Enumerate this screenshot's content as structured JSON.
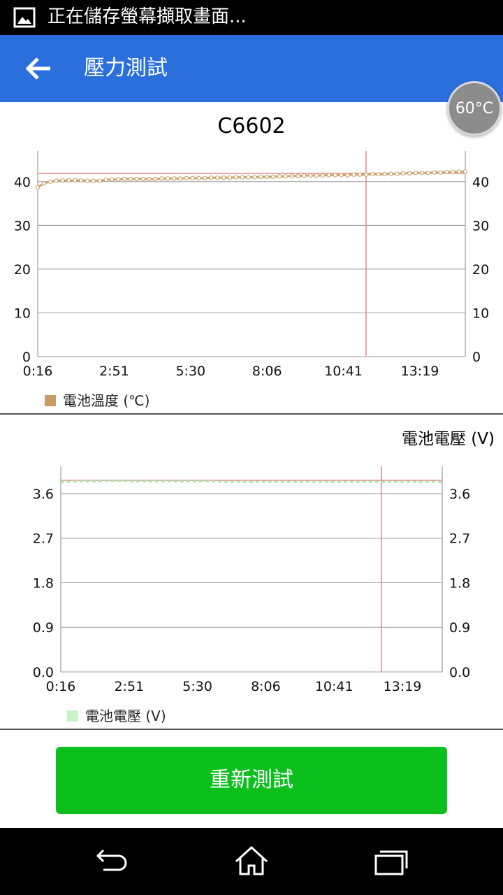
{
  "status_bar": {
    "notification_text": "正在儲存螢幕擷取畫面...",
    "icon": "image-icon"
  },
  "app_bar": {
    "title": "壓力測試",
    "back_icon": "arrow-left-icon",
    "color": "#2a6fdc"
  },
  "temperature_bubble": {
    "text": "60°C"
  },
  "device_name": "C6602",
  "temp_chart": {
    "legend": "電池溫度 (℃)",
    "color": "#d1a46e"
  },
  "voltage_chart": {
    "title": "電池電壓 (V)",
    "legend": "電池電壓 (V)",
    "color": "#c8f5c8"
  },
  "retest_button": {
    "label": "重新測試",
    "color": "#0bbf1d"
  },
  "nav_bar": {
    "icons": [
      "back-nav-icon",
      "home-icon",
      "recent-apps-icon"
    ]
  },
  "chart_data": [
    {
      "type": "line",
      "x_ticks": [
        "0:16",
        "2:51",
        "5:30",
        "8:06",
        "10:41",
        "13:19"
      ],
      "y_ticks": [
        "0",
        "10",
        "20",
        "30",
        "40"
      ],
      "ylim": [
        0,
        47
      ],
      "grid": true,
      "legend_position": "bottom-left",
      "reference_line_y": 41.9,
      "marker_x_label": "10:41",
      "series": [
        {
          "name": "電池溫度 (℃)",
          "values": [
            38.7,
            39.6,
            40.0,
            40.2,
            40.3,
            40.3,
            40.3,
            40.3,
            40.2,
            40.2,
            40.2,
            40.4,
            40.5,
            40.5,
            40.6,
            40.6,
            40.6,
            40.6,
            40.6,
            40.6,
            40.7,
            40.7,
            40.7,
            40.7,
            40.8,
            40.8,
            40.8,
            40.8,
            40.9,
            40.9,
            40.9,
            40.9,
            41.0,
            41.0,
            41.0,
            41.0,
            41.1,
            41.1,
            41.1,
            41.2,
            41.2,
            41.3,
            41.3,
            41.4,
            41.4,
            41.4,
            41.4,
            41.5,
            41.5,
            41.5,
            41.5,
            41.6,
            41.6,
            41.6,
            41.7,
            41.7,
            41.7,
            41.8,
            41.8,
            41.9,
            41.9,
            42.0,
            42.0,
            42.0,
            42.1,
            42.1,
            42.2,
            42.2,
            42.3,
            42.3
          ]
        }
      ]
    },
    {
      "type": "line",
      "x_ticks": [
        "0:16",
        "2:51",
        "5:30",
        "8:06",
        "10:41",
        "13:19"
      ],
      "y_ticks": [
        "0.0",
        "0.9",
        "1.8",
        "2.7",
        "3.6"
      ],
      "ylim": [
        0,
        4.15
      ],
      "grid": true,
      "legend_position": "bottom-left",
      "reference_line_y": 3.87,
      "marker_x_label": "12:15",
      "series": [
        {
          "name": "電池電壓 (V)",
          "values": [
            3.83,
            3.84,
            3.85,
            3.85,
            3.85,
            3.85,
            3.86,
            3.86,
            3.86,
            3.85,
            3.85,
            3.85,
            3.85,
            3.85,
            3.85,
            3.85,
            3.85,
            3.85,
            3.85,
            3.85,
            3.85,
            3.84,
            3.84,
            3.84,
            3.84,
            3.84,
            3.84,
            3.84,
            3.84,
            3.84,
            3.84,
            3.84,
            3.84,
            3.84,
            3.84,
            3.84,
            3.84,
            3.84,
            3.84,
            3.84,
            3.84,
            3.84,
            3.84,
            3.84,
            3.84,
            3.84,
            3.84,
            3.84,
            3.84,
            3.84,
            3.83
          ]
        }
      ]
    }
  ]
}
